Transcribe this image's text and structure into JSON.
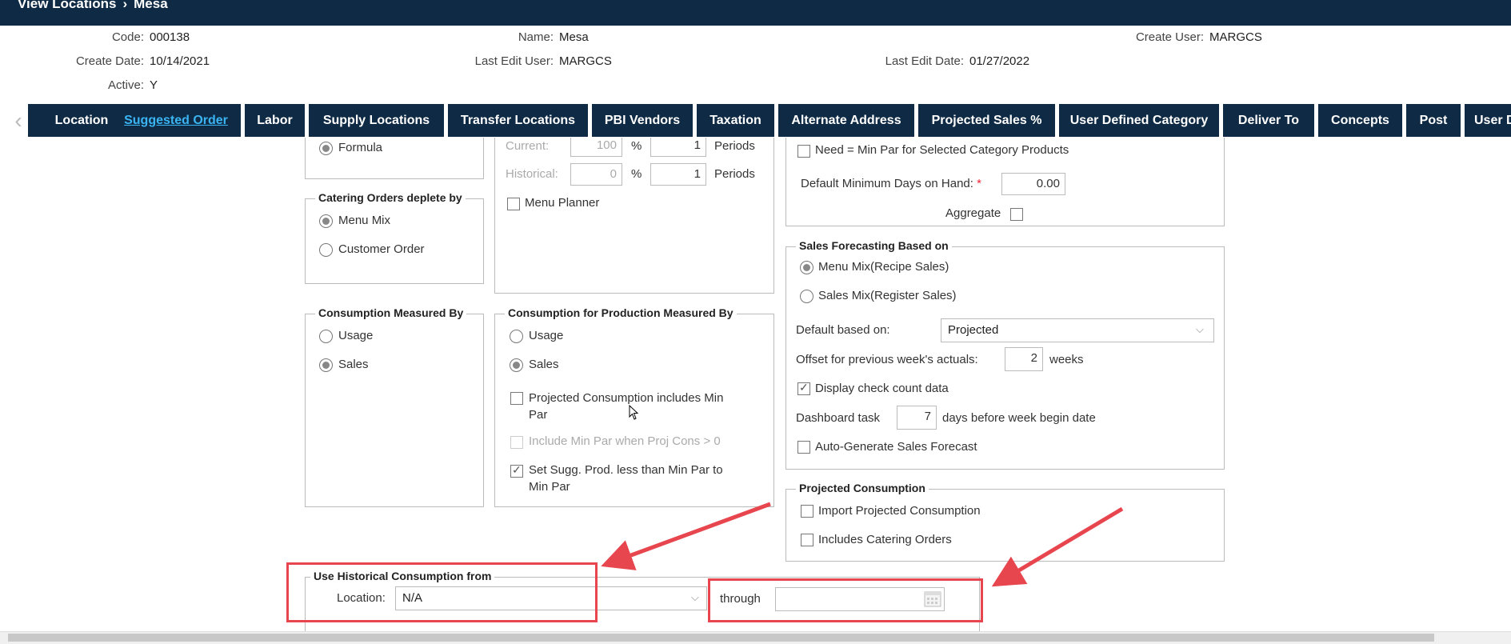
{
  "breadcrumb": {
    "root": "View Locations",
    "separator": "›",
    "current": "Mesa"
  },
  "header": {
    "code_label": "Code:",
    "code": "000138",
    "create_date_label": "Create Date:",
    "create_date": "10/14/2021",
    "active_label": "Active:",
    "active": "Y",
    "name_label": "Name:",
    "name": "Mesa",
    "last_edit_user_label": "Last Edit User:",
    "last_edit_user": "MARGCS",
    "last_edit_date_label": "Last Edit Date:",
    "last_edit_date": "01/27/2022",
    "create_user_label": "Create User:",
    "create_user": "MARGCS"
  },
  "tabs": [
    "Location",
    "Suggested Order",
    "Labor",
    "Supply Locations",
    "Transfer Locations",
    "PBI Vendors",
    "Taxation",
    "Alternate Address",
    "Projected Sales %",
    "User Defined Category",
    "Deliver To",
    "Concepts",
    "Post",
    "User D"
  ],
  "active_tab": "Suggested Order",
  "formula_box": {
    "formula_label": "Formula"
  },
  "periods_box": {
    "current_label": "Current:",
    "current_value": "100",
    "current_periods": "1",
    "historical_label": "Historical:",
    "historical_value": "0",
    "historical_periods": "1",
    "percent": "%",
    "periods_label": "Periods",
    "menu_planner_label": "Menu Planner"
  },
  "catering": {
    "legend": "Catering Orders deplete by",
    "menu_mix": "Menu Mix",
    "customer_order": "Customer Order"
  },
  "consumption": {
    "legend": "Consumption Measured By",
    "usage": "Usage",
    "sales": "Sales"
  },
  "production": {
    "legend": "Consumption for Production Measured By",
    "usage": "Usage",
    "sales": "Sales",
    "proj_cons_line1": "Projected Consumption includes Min",
    "proj_cons_line2": "Par",
    "include_min_par": "Include Min Par when Proj Cons > 0",
    "set_sugg_line1": "Set Sugg. Prod. less than Min Par to",
    "set_sugg_line2": "Min Par"
  },
  "min_par": {
    "need_label": "Need = Min Par for Selected Category Products",
    "default_min_days_label": "Default Minimum Days on Hand:",
    "required_marker": "*",
    "default_min_days_value": "0.00",
    "aggregate_label": "Aggregate"
  },
  "forecasting": {
    "legend": "Sales Forecasting Based on",
    "menu_mix": "Menu Mix(Recipe Sales)",
    "sales_mix": "Sales Mix(Register Sales)",
    "default_based_label": "Default based on:",
    "default_based_value": "Projected",
    "offset_label": "Offset for previous week's actuals:",
    "offset_value": "2",
    "weeks_label": "weeks",
    "display_check_label": "Display check count data",
    "dashboard_label": "Dashboard task",
    "dashboard_value": "7",
    "dashboard_suffix": "days before week begin date",
    "auto_generate_label": "Auto-Generate Sales Forecast"
  },
  "projected_consumption": {
    "legend": "Projected Consumption",
    "import_label": "Import Projected Consumption",
    "includes_catering_label": "Includes Catering Orders"
  },
  "historical": {
    "legend": "Use Historical Consumption from",
    "location_label": "Location:",
    "location_value": "N/A",
    "through_label": "through",
    "through_value": ""
  },
  "colors": {
    "nav": "#0f2a44",
    "active_tab_text": "#3ab4f2",
    "annotation": "#e8464e"
  },
  "icons": {
    "tab_scroll_left": "chevron-left-icon",
    "calendar": "calendar-icon",
    "dropdown": "chevron-down-icon",
    "cursor": "mouse-pointer-icon"
  }
}
